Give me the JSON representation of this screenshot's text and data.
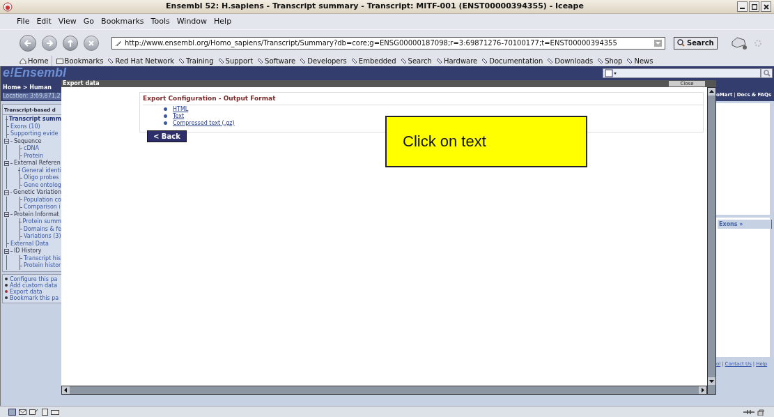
{
  "window": {
    "title": "Ensembl 52: H.sapiens - Transcript summary - Transcript: MITF-001 (ENST00000394355) - Iceape"
  },
  "menu": [
    "File",
    "Edit",
    "View",
    "Go",
    "Bookmarks",
    "Tools",
    "Window",
    "Help"
  ],
  "address": {
    "url": "http://www.ensembl.org/Homo_sapiens/Transcript/Summary?db=core;g=ENSG00000187098;r=3:69871276-70100177;t=ENST00000394355"
  },
  "search_button": "Search",
  "bookmarks": [
    {
      "label": "Home",
      "kind": "home"
    },
    {
      "label": "Bookmarks",
      "kind": "folder"
    },
    {
      "label": "Red Hat Network",
      "kind": "link"
    },
    {
      "label": "Training",
      "kind": "link"
    },
    {
      "label": "Support",
      "kind": "link"
    },
    {
      "label": "Software",
      "kind": "link"
    },
    {
      "label": "Developers",
      "kind": "link"
    },
    {
      "label": "Embedded",
      "kind": "link"
    },
    {
      "label": "Search",
      "kind": "link"
    },
    {
      "label": "Hardware",
      "kind": "link"
    },
    {
      "label": "Documentation",
      "kind": "link"
    },
    {
      "label": "Downloads",
      "kind": "link"
    },
    {
      "label": "Shop",
      "kind": "link"
    },
    {
      "label": "News",
      "kind": "link"
    }
  ],
  "page": {
    "logo": "e!Ensembl",
    "breadcrumb": "Home > Human",
    "location": "Location: 3:69,871,2",
    "sidebar": {
      "heading": "Transcript-based d",
      "tree": [
        {
          "label": "Transcript summ",
          "selected": true
        },
        {
          "label": "Exons (10)",
          "selected": false
        },
        {
          "label": "Supporting evide",
          "selected": false
        },
        {
          "label": "Sequence",
          "selected": false,
          "expanded": true,
          "children": [
            {
              "label": "cDNA",
              "selected": false
            },
            {
              "label": "Protein",
              "selected": false
            }
          ]
        },
        {
          "label": "External Referen",
          "selected": false,
          "expanded": true,
          "children": [
            {
              "label": "General identi",
              "selected": false
            },
            {
              "label": "Oligo probes",
              "selected": false
            },
            {
              "label": "Gene ontolog",
              "selected": false
            }
          ]
        },
        {
          "label": "Genetic Variation",
          "selected": false,
          "expanded": true,
          "children": [
            {
              "label": "Population co",
              "selected": false
            },
            {
              "label": "Comparison i",
              "selected": false
            }
          ]
        },
        {
          "label": "Protein Informat",
          "selected": false,
          "expanded": true,
          "children": [
            {
              "label": "Protein summ",
              "selected": false
            },
            {
              "label": "Domains & fe",
              "selected": false
            },
            {
              "label": "Variations (3)",
              "selected": false
            }
          ]
        },
        {
          "label": "External Data",
          "selected": false
        },
        {
          "label": "ID History",
          "selected": false,
          "expanded": true,
          "children": [
            {
              "label": "Transcript his",
              "selected": false
            },
            {
              "label": "Protein histor",
              "selected": false
            }
          ]
        }
      ]
    },
    "actions": [
      {
        "label": "Configure this pa",
        "color": "#333333"
      },
      {
        "label": "Add custom data",
        "color": "#333333"
      },
      {
        "label": "Export data",
        "color": "#993333"
      },
      {
        "label": "Bookmark this pa",
        "color": "#333333"
      }
    ],
    "header_links": [
      {
        "label": "oMart",
        "kind": "link"
      },
      {
        "label": "|",
        "kind": "separator"
      },
      {
        "label": "Docs & FAQs",
        "kind": "link"
      }
    ],
    "tab": "Exons »",
    "footer_links": [
      {
        "label": "ol",
        "kind": "link"
      },
      {
        "label": "|",
        "kind": "separator"
      },
      {
        "label": "Contact Us",
        "kind": "link"
      },
      {
        "label": "|",
        "kind": "separator"
      },
      {
        "label": "Help",
        "kind": "link"
      }
    ]
  },
  "modal": {
    "title": "Export data",
    "close": "Close",
    "heading": "Export Configuration - Output Format",
    "options": [
      "HTML",
      "Text",
      "Compressed text (.gz)"
    ],
    "back": "< Back"
  },
  "callout": "Click on text"
}
